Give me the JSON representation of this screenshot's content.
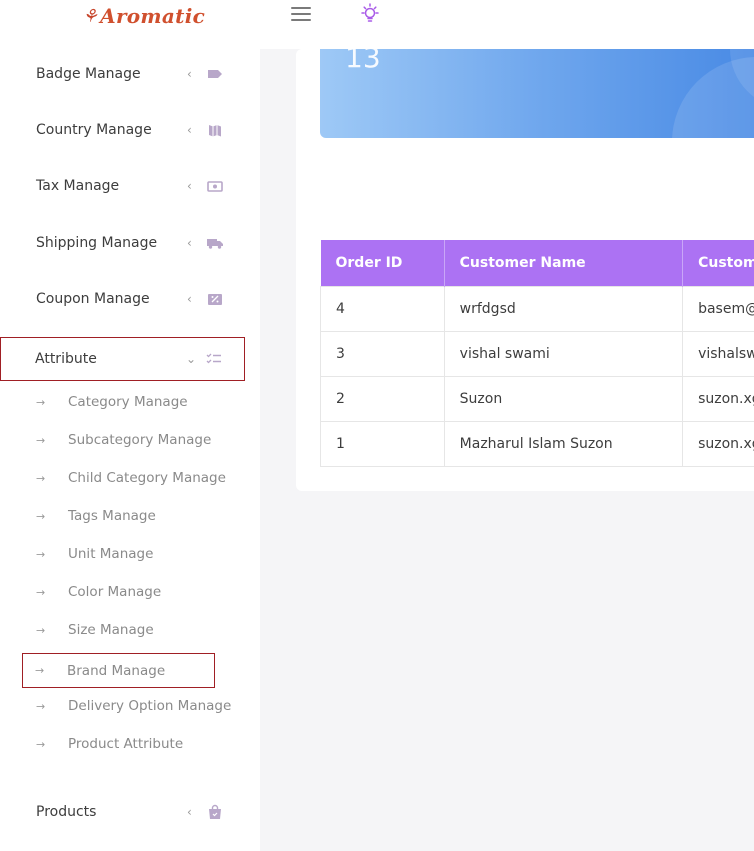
{
  "header": {
    "brand": "Aromatic",
    "menu_icon": "hamburger-icon",
    "theme_icon": "lightbulb-icon",
    "accent_color": "#ac72f3"
  },
  "sidebar": {
    "items": [
      {
        "label": "Badge Manage",
        "icon": "tag-icon"
      },
      {
        "label": "Country Manage",
        "icon": "map-icon"
      },
      {
        "label": "Tax Manage",
        "icon": "money-icon"
      },
      {
        "label": "Shipping Manage",
        "icon": "truck-icon"
      },
      {
        "label": "Coupon Manage",
        "icon": "coupon-icon"
      },
      {
        "label": "Attribute",
        "icon": "checklist-icon"
      }
    ],
    "submenu": [
      "Category Manage",
      "Subcategory Manage",
      "Child Category Manage",
      "Tags Manage",
      "Unit Manage",
      "Color Manage",
      "Size Manage",
      "Brand Manage",
      "Delivery Option Manage",
      "Product Attribute"
    ],
    "products": {
      "label": "Products",
      "icon": "bag-icon"
    }
  },
  "banner": {
    "count": "13"
  },
  "orders_table": {
    "headers": [
      "Order ID",
      "Customer Name",
      "Custome"
    ],
    "rows": [
      [
        "4",
        "wrfdgsd",
        "basem@"
      ],
      [
        "3",
        "vishal swami",
        "vishalsw"
      ],
      [
        "2",
        "Suzon",
        "suzon.xg"
      ],
      [
        "1",
        "Mazharul Islam Suzon",
        "suzon.xg"
      ]
    ]
  }
}
